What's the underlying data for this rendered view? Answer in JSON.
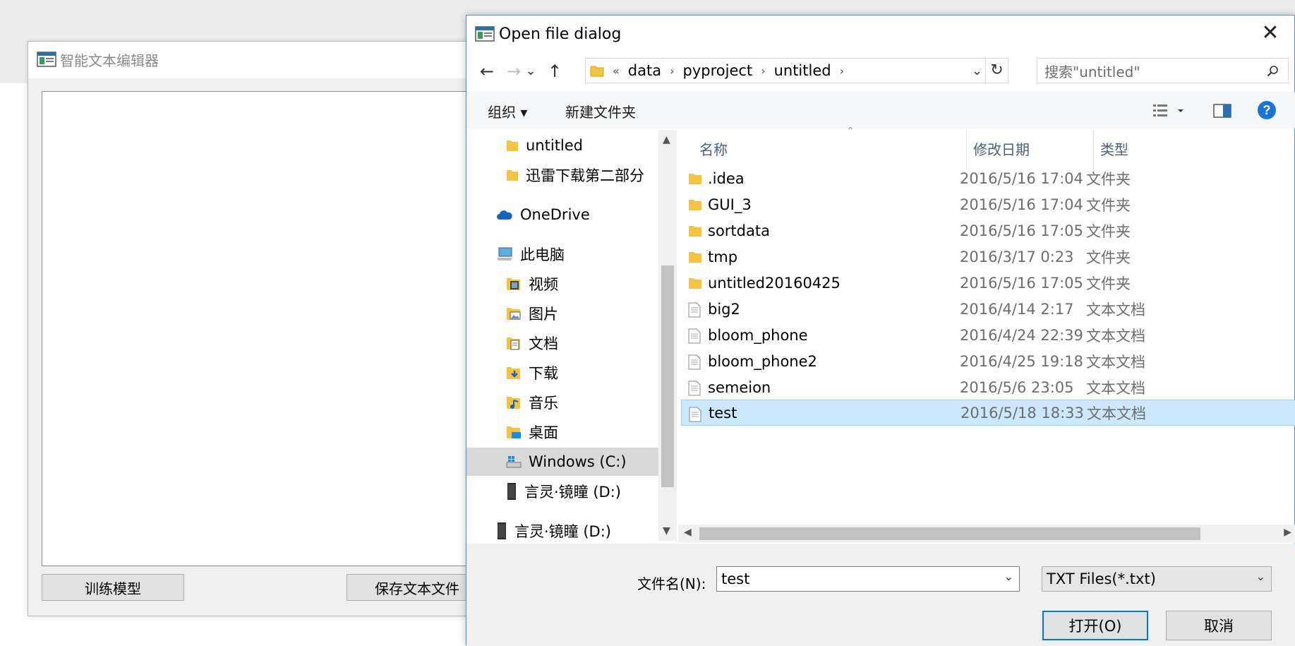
{
  "main_window": {
    "title": "智能文本编辑器",
    "train_button": "训练模型",
    "save_button": "保存文本文件"
  },
  "dialog": {
    "title": "Open file dialog",
    "close_glyph": "✕",
    "nav": {
      "back": "←",
      "forward": "→",
      "recent": "⌄",
      "up": "↑",
      "refresh": "↻"
    },
    "address": {
      "overflow": "«",
      "crumbs": [
        "data",
        "pyproject",
        "untitled"
      ],
      "separator": "›",
      "dropdown": "⌄"
    },
    "search_placeholder": "搜索\"untitled\"",
    "toolbar": {
      "organize": "组织 ▾",
      "new_folder": "新建文件夹"
    },
    "nav_pane": [
      {
        "label": "untitled",
        "icon": "folder-icon"
      },
      {
        "label": "迅雷下载第二部分",
        "icon": "folder-icon"
      },
      {
        "label": "OneDrive",
        "icon": "cloud-icon"
      },
      {
        "label": "此电脑",
        "icon": "computer-icon"
      },
      {
        "label": "视频",
        "icon": "video-folder-icon"
      },
      {
        "label": "图片",
        "icon": "pictures-folder-icon"
      },
      {
        "label": "文档",
        "icon": "documents-folder-icon"
      },
      {
        "label": "下载",
        "icon": "downloads-folder-icon"
      },
      {
        "label": "音乐",
        "icon": "music-folder-icon"
      },
      {
        "label": "桌面",
        "icon": "desktop-folder-icon"
      },
      {
        "label": "Windows (C:)",
        "icon": "drive-c-icon"
      },
      {
        "label": "言灵·镜瞳 (D:)",
        "icon": "drive-d-icon"
      },
      {
        "label": "言灵·镜瞳 (D:)",
        "icon": "drive-d-icon"
      }
    ],
    "columns": {
      "name": "名称",
      "date": "修改日期",
      "type": "类型"
    },
    "files": [
      {
        "name": ".idea",
        "date": "2016/5/16 17:04",
        "type": "文件夹",
        "kind": "folder"
      },
      {
        "name": "GUI_3",
        "date": "2016/5/16 17:04",
        "type": "文件夹",
        "kind": "folder"
      },
      {
        "name": "sortdata",
        "date": "2016/5/16 17:05",
        "type": "文件夹",
        "kind": "folder"
      },
      {
        "name": "tmp",
        "date": "2016/3/17 0:23",
        "type": "文件夹",
        "kind": "folder"
      },
      {
        "name": "untitled20160425",
        "date": "2016/5/16 17:05",
        "type": "文件夹",
        "kind": "folder"
      },
      {
        "name": "big2",
        "date": "2016/4/14 2:17",
        "type": "文本文档",
        "kind": "file"
      },
      {
        "name": "bloom_phone",
        "date": "2016/4/24 22:39",
        "type": "文本文档",
        "kind": "file"
      },
      {
        "name": "bloom_phone2",
        "date": "2016/4/25 19:18",
        "type": "文本文档",
        "kind": "file"
      },
      {
        "name": "semeion",
        "date": "2016/5/6 23:05",
        "type": "文本文档",
        "kind": "file"
      },
      {
        "name": "test",
        "date": "2016/5/18 18:33",
        "type": "文本文档",
        "kind": "file",
        "selected": true
      }
    ],
    "filename_label": "文件名(N):",
    "filename_value": "test",
    "filetype_value": "TXT Files(*.txt)",
    "open_button": "打开(O)",
    "cancel_button": "取消"
  },
  "colors": {
    "selection": "#cce8ff",
    "folder": "#f5c342",
    "accent": "#0078d7",
    "help": "#1a73d9"
  }
}
